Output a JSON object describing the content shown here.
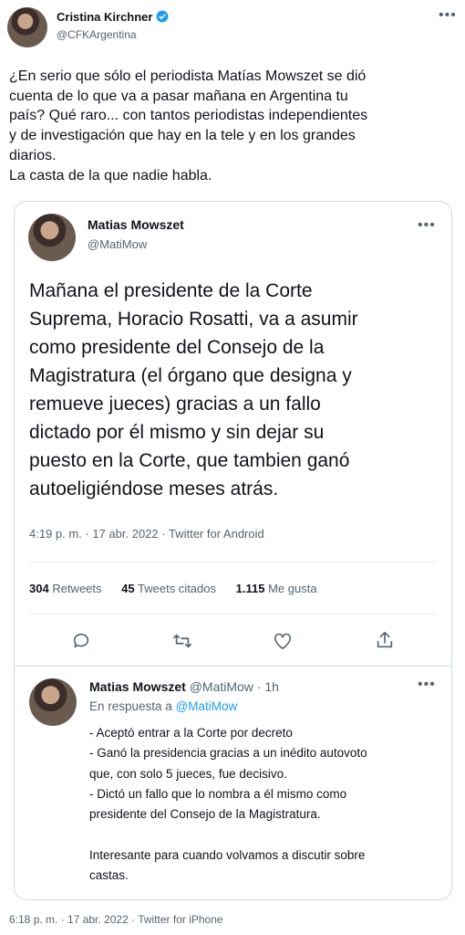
{
  "author": {
    "name": "Cristina Kirchner",
    "handle": "@CFKArgentina"
  },
  "tweet_text_lines": [
    "¿En serio que sólo el periodista Matías Mowszet se dió",
    "cuenta de lo que va a pasar mañana en Argentina tu",
    "país? Qué raro... con tantos periodistas independientes",
    "y de investigación que hay en la tele y en los grandes",
    "diarios.",
    "La casta de la que nadie habla."
  ],
  "quoted": {
    "name": "Matias Mowszet",
    "handle": "@MatiMow",
    "text_lines": [
      "Mañana el presidente de la Corte",
      "Suprema, Horacio Rosatti, va a asumir",
      "como presidente del Consejo de la",
      "Magistratura (el órgano que designa y",
      "remueve jueces) gracias a un fallo",
      "dictado por él mismo y sin dejar su",
      "puesto en la Corte, que tambien ganó",
      "autoeligiéndose meses atrás."
    ],
    "meta": "4:19 p. m. · 17 abr. 2022 · Twitter for Android",
    "stats": {
      "retweets_count": "304",
      "retweets_label": "Retweets",
      "quotes_count": "45",
      "quotes_label": "Tweets citados",
      "likes_count": "1.115",
      "likes_label": "Me gusta"
    }
  },
  "reply": {
    "name": "Matias Mowszet",
    "handle_time": "@MatiMow · 1h",
    "reply_prefix": "En respuesta a",
    "reply_to": "@MatiMow",
    "text_lines": [
      "- Aceptó entrar a la Corte por decreto",
      "- Ganó la presidencia gracias a un inédito autovoto",
      "que, con solo 5 jueces, fue decisivo.",
      "- Dictó un fallo que lo nombra a él mismo como",
      "presidente del Consejo de la Magistratura.",
      "",
      "Interesante para cuando volvamos a discutir sobre",
      "castas."
    ]
  },
  "footer_meta": "6:18 p. m. · 17 abr. 2022 · Twitter for iPhone",
  "colors": {
    "link": "#1d9bf0",
    "muted": "#536471",
    "text": "#0f1419",
    "border": "#cfd9de"
  }
}
